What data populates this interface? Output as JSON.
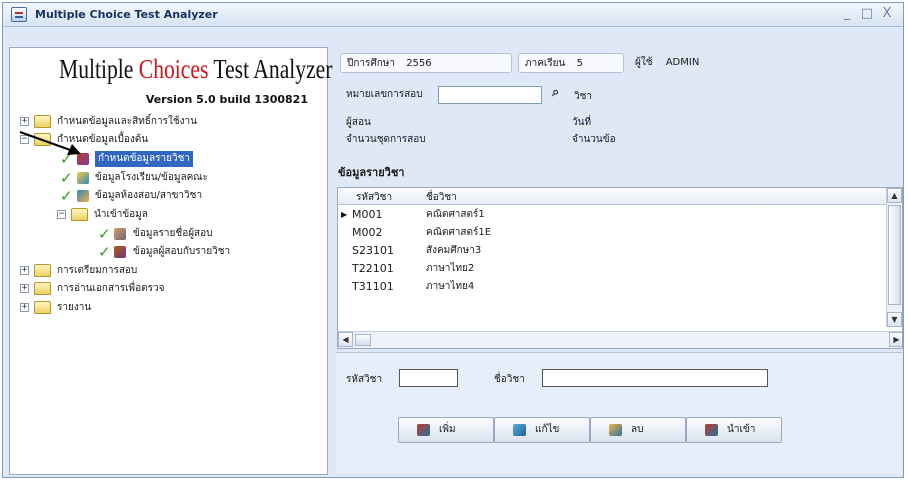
{
  "window": {
    "title": "Multiple Choice Test Analyzer",
    "minimize_glyph": "_",
    "maximize_glyph": "□",
    "close_glyph": "X"
  },
  "header": {
    "app_name_part1": "Multiple ",
    "app_name_accent": "Choices",
    "app_name_part2": " Test Analyzer",
    "version": "Version 5.0  build 1300821",
    "accent_color": "#d4141c"
  },
  "tree": {
    "expand_glyph": "+",
    "collapse_glyph": "−",
    "items": [
      {
        "label": "กำหนดข้อมูลและสิทธิ์การใช้งาน",
        "icon": "folder-icon"
      },
      {
        "label": "กำหนดข้อมูลเบื้องต้น",
        "icon": "folder-icon"
      },
      {
        "label": "กำหนดข้อมูลรายวิชา",
        "icon": "book-icon",
        "selected": true
      },
      {
        "label": "ข้อมูลโรงเรียน/ข้อมูลคณะ",
        "icon": "school-icon"
      },
      {
        "label": "ข้อมูลห้องสอบ/สาขาวิชา",
        "icon": "room-icon"
      },
      {
        "label": "นำเข้าข้อมูล",
        "icon": "folder-icon"
      },
      {
        "label": "ข้อมูลรายชื่อผู้สอบ",
        "icon": "user-icon"
      },
      {
        "label": "ข้อมูลผู้สอบกับรายวิชา",
        "icon": "users-icon"
      },
      {
        "label": "การเตรียมการสอบ",
        "icon": "folder-icon"
      },
      {
        "label": "การอ่านเอกสารเพื่อตรวจ",
        "icon": "folder-icon"
      },
      {
        "label": "รายงาน",
        "icon": "folder-icon"
      }
    ]
  },
  "info": {
    "year_label": "ปีการศึกษา",
    "year_value": "2556",
    "term_label": "ภาคเรียน",
    "term_value": "5",
    "user_label": "ผู้ใช้",
    "user_value": "ADMIN",
    "exam_no_label": "หมายเลขการสอบ",
    "exam_no_value": "",
    "subject_label": "วิชา",
    "teacher_label": "ผู้สอน",
    "date_label": "วันที่",
    "sets_label": "จำนวนชุดการสอบ",
    "items_label": "จำนวนข้อ"
  },
  "subjects": {
    "section_title": "ข้อมูลรายวิชา",
    "columns": [
      "รหัสวิชา",
      "ชื่อวิชา"
    ],
    "rows": [
      {
        "code": "M001",
        "name": "คณิตศาสตร์1"
      },
      {
        "code": "M002",
        "name": "คณิตศาสตร์1E"
      },
      {
        "code": "S23101",
        "name": "สังคมศึกษา3"
      },
      {
        "code": "T22101",
        "name": "ภาษาไทย2"
      },
      {
        "code": "T31101",
        "name": "ภาษาไทย4"
      }
    ],
    "current_row_marker": "▶"
  },
  "form": {
    "code_label": "รหัสวิชา",
    "code_value": "",
    "name_label": "ชื่อวิชา",
    "name_value": ""
  },
  "actions": {
    "add_label": "เพิ่ม",
    "edit_label": "แก้ไข",
    "delete_label": "ลบ",
    "import_label": "นำเข้า"
  },
  "colors": {
    "window_bg": "#dfe8f6",
    "selection": "#3166c1",
    "check": "#2f9e20"
  }
}
